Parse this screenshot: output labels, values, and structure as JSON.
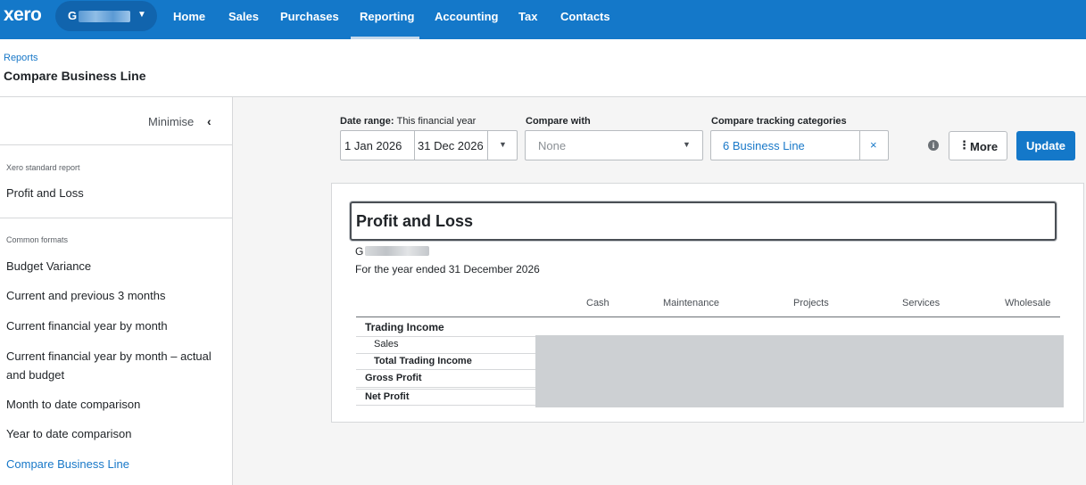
{
  "nav": {
    "logo": "xero",
    "org_initial": "G",
    "items": [
      {
        "label": "Home"
      },
      {
        "label": "Sales"
      },
      {
        "label": "Purchases"
      },
      {
        "label": "Reporting",
        "active": true
      },
      {
        "label": "Accounting"
      },
      {
        "label": "Tax"
      },
      {
        "label": "Contacts"
      }
    ],
    "brand_color": "#1478c9"
  },
  "header": {
    "breadcrumb": "Reports",
    "title": "Compare Business Line"
  },
  "sidebar": {
    "minimise_label": "Minimise",
    "standard_section": "Xero standard report",
    "standard_items": [
      {
        "label": "Profit and Loss"
      }
    ],
    "common_section": "Common formats",
    "common_items": [
      {
        "label": "Budget Variance"
      },
      {
        "label": "Current and previous 3 months"
      },
      {
        "label": "Current financial year by month"
      },
      {
        "label": "Current financial year by month – actual and budget"
      },
      {
        "label": "Month to date comparison"
      },
      {
        "label": "Year to date comparison"
      },
      {
        "label": "Compare Business Line",
        "active": true
      }
    ]
  },
  "controls": {
    "date_range_label": "Date range:",
    "date_range_preset": "This financial year",
    "date_from": "1 Jan 2026",
    "date_to": "31 Dec 2026",
    "compare_with_label": "Compare with",
    "compare_with_value": "None",
    "tracking_label": "Compare tracking categories",
    "tracking_value": "6 Business Line",
    "tracking_clear": "×",
    "info_icon": "i",
    "more_label": "More",
    "update_label": "Update"
  },
  "report": {
    "title": "Profit and Loss",
    "org_initial": "G",
    "period": "For the year ended 31 December 2026",
    "columns": [
      "Cash",
      "Maintenance",
      "Projects",
      "Services",
      "Wholesale"
    ],
    "rows": [
      {
        "label": "Trading Income"
      },
      {
        "label": "Sales"
      },
      {
        "label": "Total Trading Income"
      },
      {
        "label": "Gross Profit"
      },
      {
        "label": "Net Profit"
      }
    ]
  }
}
